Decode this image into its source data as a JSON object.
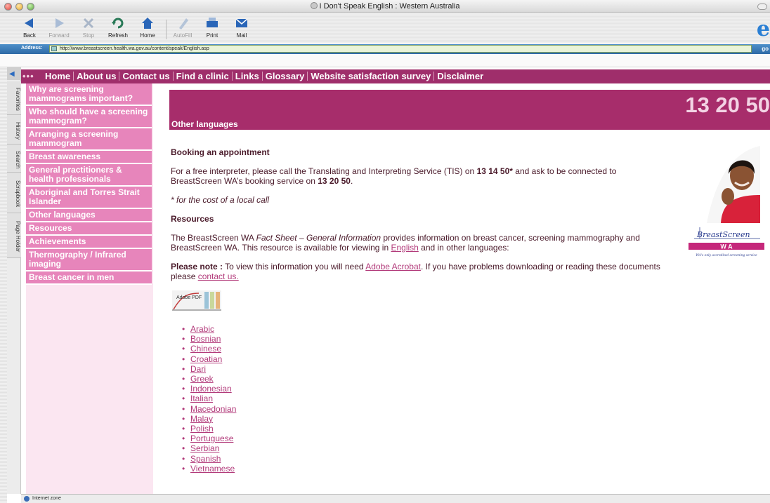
{
  "window": {
    "title": "I Don't Speak English : Western Australia"
  },
  "toolbar": {
    "buttons": [
      {
        "label": "Back",
        "icon": "back-arrow-icon",
        "enabled": true
      },
      {
        "label": "Forward",
        "icon": "forward-arrow-icon",
        "enabled": false
      },
      {
        "label": "Stop",
        "icon": "stop-icon",
        "enabled": false
      },
      {
        "label": "Refresh",
        "icon": "refresh-icon",
        "enabled": true
      },
      {
        "label": "Home",
        "icon": "home-icon",
        "enabled": true
      },
      {
        "label": "AutoFill",
        "icon": "autofill-icon",
        "enabled": false
      },
      {
        "label": "Print",
        "icon": "print-icon",
        "enabled": true
      },
      {
        "label": "Mail",
        "icon": "mail-icon",
        "enabled": true
      }
    ]
  },
  "address": {
    "label": "Address:",
    "url": "http://www.breastscreen.health.wa.gov.au/content/speak/English.asp",
    "go_label": "go"
  },
  "sidebar_tabs": [
    "Favorites",
    "History",
    "Search",
    "Scrapbook",
    "Page Holder"
  ],
  "status": {
    "text": "Internet zone"
  },
  "sitenav": {
    "links": [
      "Home",
      "About us",
      "Contact us",
      "Find a clinic",
      "Links",
      "Glossary",
      "Website satisfaction survey",
      "Disclaimer"
    ]
  },
  "leftmenu": {
    "items": [
      "Why are screening mammograms important?",
      "Who should have a screening mammogram?",
      "Arranging a screening mammogram",
      "Breast awareness",
      "General practitioners & health professionals",
      "Aboriginal and Torres Strait Islander",
      "Other languages",
      "Resources",
      "Achievements",
      "Thermography / Infrared imaging",
      "Breast cancer in men"
    ]
  },
  "banner": {
    "phone": "13 20 50",
    "heading": "Other languages"
  },
  "content": {
    "booking_heading": "Booking an appointment",
    "booking_text_1": "For a free interpreter, please call the Translating and Interpreting Service (TIS) on ",
    "tis_number": "13 14 50*",
    "booking_text_2": " and ask to be connected to BreastScreen WA’s booking service on ",
    "booking_number": "13 20 50",
    "booking_text_3": ".",
    "local_call_note": "* for the cost of a local call",
    "resources_heading": "Resources",
    "resources_text_1": "The BreastScreen WA ",
    "resources_italic": "Fact Sheet – General Information",
    "resources_text_2": " provides information on breast cancer, screening mammography and BreastScreen WA. This resource is available for viewing in ",
    "english_link": "English",
    "resources_text_3": " and in other languages:",
    "note_label": "Please note :",
    "note_text_1": " To view this information you will need ",
    "acrobat_link": "Adobe Acrobat",
    "note_text_2": ". If you have problems downloading or reading these documents please ",
    "contact_link": "contact us.",
    "pdf_badge_text": "Adobe PDF",
    "languages": [
      "Arabic",
      "Bosnian",
      "Chinese",
      "Croatian",
      "Dari",
      "Greek",
      "Indonesian",
      "Italian",
      "Macedonian",
      "Malay",
      "Polish",
      "Portuguese",
      "Serbian",
      "Spanish",
      "Vietnamese"
    ]
  },
  "logo": {
    "name": "BreastScreen",
    "wa": "W A",
    "tagline": "WA's only accredited screening service"
  },
  "colors": {
    "brand_magenta": "#a72d6b",
    "menu_pink": "#e785bb",
    "link": "#b23a7a"
  }
}
